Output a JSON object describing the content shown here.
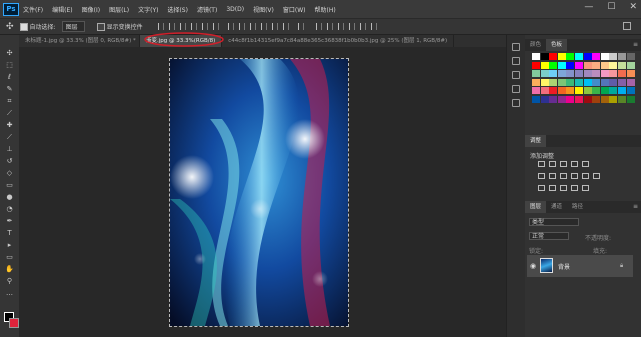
{
  "menu": {
    "logo": "Ps",
    "items": [
      "文件(F)",
      "编辑(E)",
      "图像(I)",
      "图层(L)",
      "文字(Y)",
      "选择(S)",
      "滤镜(T)",
      "3D(D)",
      "视图(V)",
      "窗口(W)",
      "帮助(H)"
    ],
    "window_controls": [
      "—",
      "☐",
      "✕"
    ]
  },
  "options": {
    "auto_select_label": "自动选择:",
    "auto_select_value": "图层",
    "show_transform_label": "显示变换控件"
  },
  "tabs": [
    {
      "label": "未标题-1.jpg @ 33.3% (图层 0, RGB/8#) *",
      "active": false
    },
    {
      "label": "渐变.jpg @ 33.3%(RGB/8)",
      "active": true
    },
    {
      "label": "c44c8f1b14315ef9a7c84a88e365c36838f1b0b0b3.jpg @ 25% (图层 1, RGB/8#)",
      "active": false
    }
  ],
  "panels": {
    "swatches_tabs": [
      "颜色",
      "色板"
    ],
    "adjust_tab": "调整",
    "adjust_title": "添加调整",
    "layers_tabs": [
      "图层",
      "通道",
      "路径"
    ],
    "layer_kind_label": "类型",
    "blend_mode": "正常",
    "opacity_label": "不透明度:",
    "lock_label": "锁定:",
    "fill_label": "填充:",
    "layer_name": "背景"
  },
  "colors": {
    "accent": "#31a8ff",
    "annotation": "#d11f2a",
    "foreground": "#000000",
    "background": "#e0243c"
  }
}
